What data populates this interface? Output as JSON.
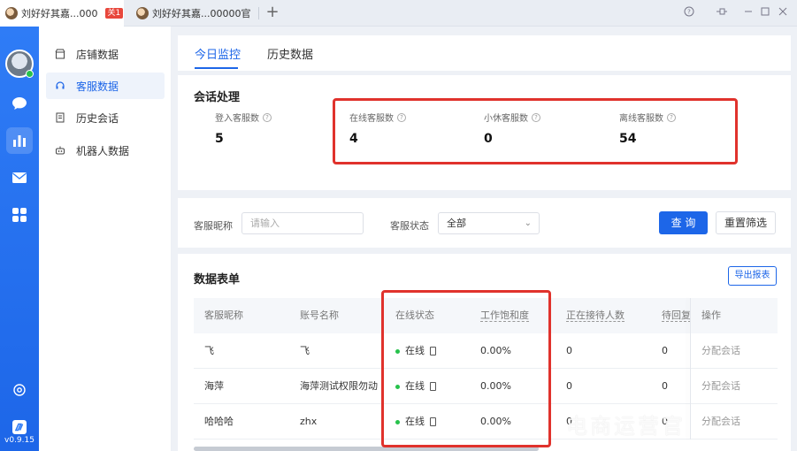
{
  "titlebar": {
    "tabs": [
      {
        "label": "刘好好其嘉...000",
        "badge": "关1"
      },
      {
        "label": "刘好好其嘉...00000官"
      }
    ],
    "add_label": "+"
  },
  "leftnav": {
    "version": "v0.9.15",
    "icons": [
      "chat-icon",
      "chart-icon",
      "mail-icon",
      "apps-icon",
      "settings-icon",
      "logo-icon"
    ]
  },
  "subnav": {
    "items": [
      {
        "label": "店铺数据",
        "icon": "store-icon"
      },
      {
        "label": "客服数据",
        "icon": "headset-icon"
      },
      {
        "label": "历史会话",
        "icon": "history-icon"
      },
      {
        "label": "机器人数据",
        "icon": "robot-icon"
      }
    ]
  },
  "content_tabs": [
    "今日监控",
    "历史数据"
  ],
  "session": {
    "title": "会话处理",
    "stats": [
      {
        "label": "登入客服数",
        "value": "5"
      },
      {
        "label": "在线客服数",
        "value": "4"
      },
      {
        "label": "小休客服数",
        "value": "0"
      },
      {
        "label": "离线客服数",
        "value": "54"
      }
    ]
  },
  "filter": {
    "nickname_label": "客服昵称",
    "nickname_placeholder": "请输入",
    "status_label": "客服状态",
    "status_value": "全部",
    "query_label": "查 询",
    "reset_label": "重置筛选"
  },
  "table": {
    "title": "数据表单",
    "export_label": "导出报表",
    "columns": [
      "客服昵称",
      "账号名称",
      "在线状态",
      "工作饱和度",
      "正在接待人数",
      "待回复",
      "操作"
    ],
    "rows": [
      {
        "nickname": "飞",
        "account": "飞",
        "status": "在线",
        "saturation": "0.00%",
        "receiving": "0",
        "pending": "0",
        "action": "分配会话"
      },
      {
        "nickname": "海萍",
        "account": "海萍测试权限勿动",
        "status": "在线",
        "saturation": "0.00%",
        "receiving": "0",
        "pending": "0",
        "action": "分配会话"
      },
      {
        "nickname": "哈哈哈",
        "account": "zhx",
        "status": "在线",
        "saturation": "0.00%",
        "receiving": "0",
        "pending": "0",
        "action": "分配会话"
      }
    ]
  },
  "watermark": "电商运营官",
  "colors": {
    "accent": "#1d66e8",
    "highlight": "#e0322c",
    "online": "#27c24c"
  }
}
